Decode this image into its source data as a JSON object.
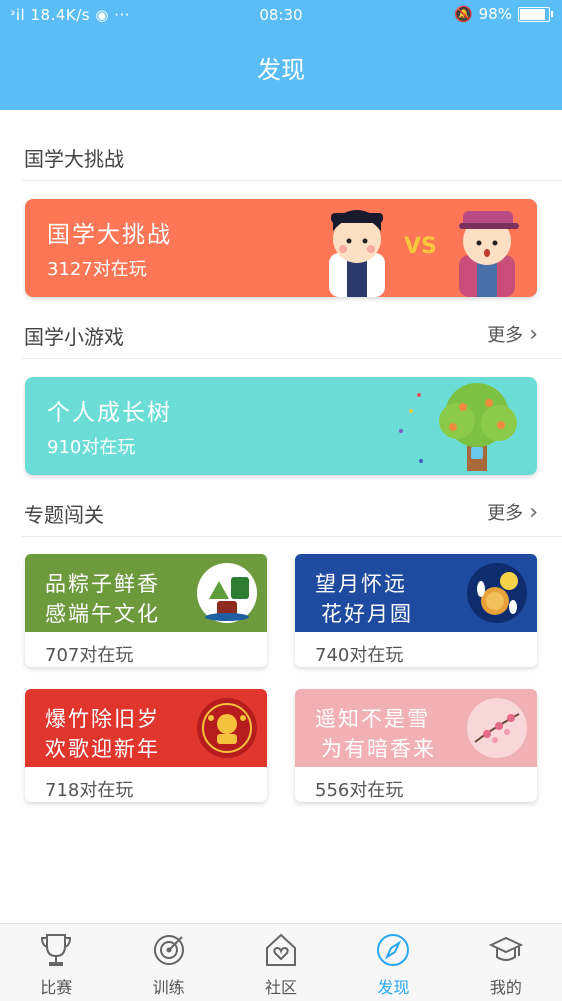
{
  "status_bar": {
    "left": "ᵌil 18.4K/s ◉ ···",
    "time": "08:30",
    "battery": "98%",
    "battery_level": 0.98
  },
  "header": {
    "title": "发现"
  },
  "sections": {
    "challenge": {
      "title": "国学大挑战"
    },
    "mini_games": {
      "title": "国学小游戏",
      "more": "更多"
    },
    "topics": {
      "title": "专题闯关",
      "more": "更多"
    }
  },
  "challenge_banner": {
    "title": "国学大挑战",
    "count": "3127对在玩",
    "vs": "VS",
    "color": "#fd7656"
  },
  "growth_banner": {
    "title": "个人成长树",
    "count": "910对在玩",
    "color": "#6cddd6"
  },
  "topic_cards": [
    {
      "line1": "品粽子鲜香",
      "line2": "感端午文化",
      "count": "707对在玩",
      "color": "#6e9a3e"
    },
    {
      "line1": "望月怀远",
      "line2": "花好月圆",
      "count": "740对在玩",
      "color": "#1e4a9f"
    },
    {
      "line1": "爆竹除旧岁",
      "line2": "欢歌迎新年",
      "count": "718对在玩",
      "color": "#e0362d"
    },
    {
      "line1": "遥知不是雪",
      "line2": "为有暗香来",
      "count": "556对在玩",
      "color": "#f1b1b4"
    }
  ],
  "tabs": [
    {
      "label": "比赛",
      "icon": "trophy-icon"
    },
    {
      "label": "训练",
      "icon": "target-icon"
    },
    {
      "label": "社区",
      "icon": "house-heart-icon"
    },
    {
      "label": "发现",
      "icon": "compass-icon",
      "active": true
    },
    {
      "label": "我的",
      "icon": "graduation-cap-icon"
    }
  ],
  "accent_color": "#5bbdf6"
}
